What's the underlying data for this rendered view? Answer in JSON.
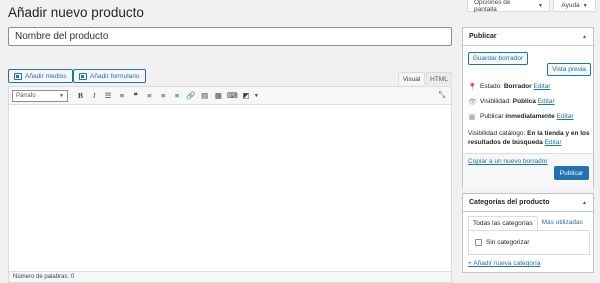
{
  "page": {
    "title": "Añadir nuevo producto"
  },
  "top": {
    "screen_options": "Opciones de pantalla",
    "help": "Ayuda"
  },
  "title_field": {
    "value": "Nombre del producto"
  },
  "editor": {
    "add_media": "Añadir medios",
    "add_form": "Añadir formulario",
    "tabs": [
      "Visual",
      "HTML"
    ],
    "format_select": "Párrafo",
    "toolbar_icons": [
      "bold-icon",
      "italic-icon",
      "bullet-list-icon",
      "numbered-list-icon",
      "blockquote-icon",
      "align-left-icon",
      "align-center-icon",
      "align-right-icon",
      "link-icon",
      "read-more-icon",
      "toolbar-toggle-icon",
      "keyboard-icon",
      "form-icon"
    ],
    "word_count": "Número de palabras: 0"
  },
  "publish": {
    "heading": "Publicar",
    "save_draft": "Guardar borrador",
    "preview": "Vista previa",
    "status_label": "Estado:",
    "status_value": "Borrador",
    "edit": "Editar",
    "visibility_label": "Visibilidad:",
    "visibility_value": "Pública",
    "publish_label": "Publicar",
    "publish_value": "inmediatamente",
    "catalog_label": "Visibilidad catálogo:",
    "catalog_value": "En la tienda y en los resultados de búsqueda",
    "copy_draft": "Copiar a un nuevo borrador",
    "publish_button": "Publicar"
  },
  "categories": {
    "heading": "Categorías del producto",
    "tab_all": "Todas las categorías",
    "tab_popular": "Más utilizadas",
    "item": "Sin categorizar",
    "add_new": "+ Añadir nueva categoría"
  },
  "colors": {
    "accent": "#2271b1",
    "background": "#f1f1f1"
  }
}
